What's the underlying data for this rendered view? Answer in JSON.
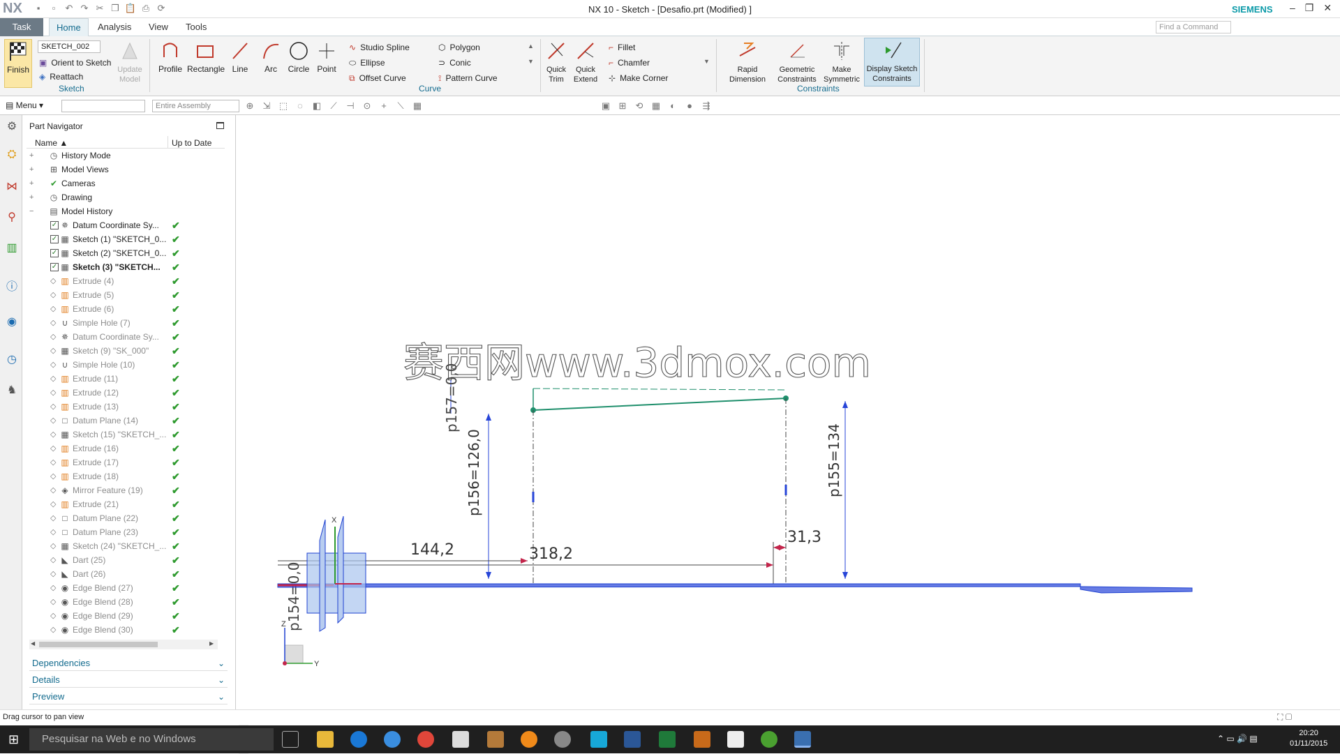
{
  "titlebar": {
    "logo": "NX",
    "title": "NX 10 - Sketch - [Desafio.prt (Modified) ]",
    "brand": "SIEMENS",
    "find_placeholder": "Find a Command"
  },
  "tabs": [
    "Task",
    "Home",
    "Analysis",
    "View",
    "Tools"
  ],
  "ribbon": {
    "finish": "Finish",
    "sketch_name": "SKETCH_002",
    "orient": "Orient to Sketch",
    "reattach": "Reattach",
    "update_model": "Update Model",
    "sketch_group": "Sketch",
    "profile": "Profile",
    "rectangle": "Rectangle",
    "line": "Line",
    "arc": "Arc",
    "circle": "Circle",
    "point": "Point",
    "studio_spline": "Studio Spline",
    "ellipse": "Ellipse",
    "offset_curve": "Offset Curve",
    "polygon": "Polygon",
    "conic": "Conic",
    "pattern_curve": "Pattern Curve",
    "curve_group": "Curve",
    "quick_trim": "Quick Trim",
    "quick_extend": "Quick Extend",
    "fillet": "Fillet",
    "chamfer": "Chamfer",
    "make_corner": "Make Corner",
    "rapid_dimension": "Rapid Dimension",
    "geometric_constraints": "Geometric Constraints",
    "make_symmetric": "Make Symmetric",
    "display_sketch_constraints": "Display Sketch Constraints",
    "constraints_group": "Constraints"
  },
  "toolbar2": {
    "menu": "Menu",
    "filter_placeholder": "Entire Assembly"
  },
  "navigator": {
    "title": "Part Navigator",
    "col_name": "Name",
    "col_uptodate": "Up to Date",
    "rows": [
      {
        "label": "History Mode",
        "indent": 0,
        "glyph": "◷",
        "check": "",
        "dim": false,
        "bold": false,
        "cb": false
      },
      {
        "label": "Model Views",
        "indent": 0,
        "glyph": "⊞",
        "check": "",
        "dim": false,
        "bold": false,
        "cb": false
      },
      {
        "label": "Cameras",
        "indent": 0,
        "glyph": "✔",
        "check": "",
        "dim": false,
        "bold": false,
        "cb": false
      },
      {
        "label": "Drawing",
        "indent": 0,
        "glyph": "◷",
        "check": "",
        "dim": false,
        "bold": false,
        "cb": false
      },
      {
        "label": "Model History",
        "indent": 0,
        "glyph": "▤",
        "check": "",
        "dim": false,
        "bold": false,
        "cb": false
      },
      {
        "label": "Datum Coordinate Sy...",
        "indent": 1,
        "glyph": "✵",
        "check": "✔",
        "dim": false,
        "bold": false,
        "cb": true
      },
      {
        "label": "Sketch (1) \"SKETCH_0...",
        "indent": 1,
        "glyph": "▦",
        "check": "✔",
        "dim": false,
        "bold": false,
        "cb": true
      },
      {
        "label": "Sketch (2) \"SKETCH_0...",
        "indent": 1,
        "glyph": "▦",
        "check": "✔",
        "dim": false,
        "bold": false,
        "cb": true
      },
      {
        "label": "Sketch (3) \"SKETCH...",
        "indent": 1,
        "glyph": "▦",
        "check": "✔",
        "dim": false,
        "bold": true,
        "cb": true
      },
      {
        "label": "Extrude (4)",
        "indent": 1,
        "glyph": "▥",
        "check": "✔",
        "dim": true,
        "bold": false,
        "cb": false
      },
      {
        "label": "Extrude (5)",
        "indent": 1,
        "glyph": "▥",
        "check": "✔",
        "dim": true,
        "bold": false,
        "cb": false
      },
      {
        "label": "Extrude (6)",
        "indent": 1,
        "glyph": "▥",
        "check": "✔",
        "dim": true,
        "bold": false,
        "cb": false
      },
      {
        "label": "Simple Hole (7)",
        "indent": 1,
        "glyph": "∪",
        "check": "✔",
        "dim": true,
        "bold": false,
        "cb": false
      },
      {
        "label": "Datum Coordinate Sy...",
        "indent": 1,
        "glyph": "✵",
        "check": "✔",
        "dim": true,
        "bold": false,
        "cb": false
      },
      {
        "label": "Sketch (9) \"SK_000\"",
        "indent": 1,
        "glyph": "▦",
        "check": "✔",
        "dim": true,
        "bold": false,
        "cb": false
      },
      {
        "label": "Simple Hole (10)",
        "indent": 1,
        "glyph": "∪",
        "check": "✔",
        "dim": true,
        "bold": false,
        "cb": false
      },
      {
        "label": "Extrude (11)",
        "indent": 1,
        "glyph": "▥",
        "check": "✔",
        "dim": true,
        "bold": false,
        "cb": false
      },
      {
        "label": "Extrude (12)",
        "indent": 1,
        "glyph": "▥",
        "check": "✔",
        "dim": true,
        "bold": false,
        "cb": false
      },
      {
        "label": "Extrude (13)",
        "indent": 1,
        "glyph": "▥",
        "check": "✔",
        "dim": true,
        "bold": false,
        "cb": false
      },
      {
        "label": "Datum Plane (14)",
        "indent": 1,
        "glyph": "□",
        "check": "✔",
        "dim": true,
        "bold": false,
        "cb": false
      },
      {
        "label": "Sketch (15) \"SKETCH_...",
        "indent": 1,
        "glyph": "▦",
        "check": "✔",
        "dim": true,
        "bold": false,
        "cb": false
      },
      {
        "label": "Extrude (16)",
        "indent": 1,
        "glyph": "▥",
        "check": "✔",
        "dim": true,
        "bold": false,
        "cb": false
      },
      {
        "label": "Extrude (17)",
        "indent": 1,
        "glyph": "▥",
        "check": "✔",
        "dim": true,
        "bold": false,
        "cb": false
      },
      {
        "label": "Extrude (18)",
        "indent": 1,
        "glyph": "▥",
        "check": "✔",
        "dim": true,
        "bold": false,
        "cb": false
      },
      {
        "label": "Mirror Feature (19)",
        "indent": 1,
        "glyph": "◈",
        "check": "✔",
        "dim": true,
        "bold": false,
        "cb": false
      },
      {
        "label": "Extrude (21)",
        "indent": 1,
        "glyph": "▥",
        "check": "✔",
        "dim": true,
        "bold": false,
        "cb": false
      },
      {
        "label": "Datum Plane (22)",
        "indent": 1,
        "glyph": "□",
        "check": "✔",
        "dim": true,
        "bold": false,
        "cb": false
      },
      {
        "label": "Datum Plane (23)",
        "indent": 1,
        "glyph": "□",
        "check": "✔",
        "dim": true,
        "bold": false,
        "cb": false
      },
      {
        "label": "Sketch (24) \"SKETCH_...",
        "indent": 1,
        "glyph": "▦",
        "check": "✔",
        "dim": true,
        "bold": false,
        "cb": false
      },
      {
        "label": "Dart (25)",
        "indent": 1,
        "glyph": "◣",
        "check": "✔",
        "dim": true,
        "bold": false,
        "cb": false
      },
      {
        "label": "Dart (26)",
        "indent": 1,
        "glyph": "◣",
        "check": "✔",
        "dim": true,
        "bold": false,
        "cb": false
      },
      {
        "label": "Edge Blend (27)",
        "indent": 1,
        "glyph": "◉",
        "check": "✔",
        "dim": true,
        "bold": false,
        "cb": false
      },
      {
        "label": "Edge Blend (28)",
        "indent": 1,
        "glyph": "◉",
        "check": "✔",
        "dim": true,
        "bold": false,
        "cb": false
      },
      {
        "label": "Edge Blend (29)",
        "indent": 1,
        "glyph": "◉",
        "check": "✔",
        "dim": true,
        "bold": false,
        "cb": false
      },
      {
        "label": "Edge Blend (30)",
        "indent": 1,
        "glyph": "◉",
        "check": "✔",
        "dim": true,
        "bold": false,
        "cb": false
      }
    ],
    "panels": [
      "Dependencies",
      "Details",
      "Preview"
    ]
  },
  "sketch": {
    "watermark": "赛西网www.3dmox.com",
    "dim_144": "144,2",
    "dim_318": "318,2",
    "dim_31": "31,3",
    "dim_p156": "p156=126,0",
    "dim_p155": "p155=134",
    "dim_p154": "p154=0,0",
    "dim_p157": "p157=0,0",
    "axis_x": "X",
    "axis_y": "Y",
    "axis_z": "Z",
    "colors": {
      "sketch_line": "#1f8f6c",
      "profile": "#2745d8",
      "dimension": "#c3254b",
      "axis": "#1e40d0"
    }
  },
  "status": {
    "text": "Drag cursor to pan view"
  },
  "taskbar": {
    "search": "Pesquisar na Web e no Windows",
    "time": "20:20",
    "date": "01/11/2015"
  }
}
